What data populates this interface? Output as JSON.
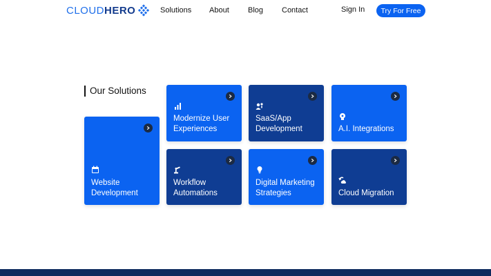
{
  "brand": {
    "part1": "CLOUD",
    "part2": "HERO"
  },
  "nav": {
    "items": [
      "Solutions",
      "About",
      "Blog",
      "Contact"
    ],
    "signin": "Sign In",
    "cta": "Try For Free"
  },
  "section": {
    "title": "Our Solutions"
  },
  "cards": [
    {
      "title": "Website Development",
      "icon": "calendar-icon"
    },
    {
      "title": "Modernize User Experiences",
      "icon": "bar-chart-icon"
    },
    {
      "title": "SaaS/App Development",
      "icon": "users-icon"
    },
    {
      "title": "A.I. Integrations",
      "icon": "lightbulb-head-icon"
    },
    {
      "title": "Workflow Automations",
      "icon": "robot-arm-icon"
    },
    {
      "title": "Digital Marketing Strategies",
      "icon": "lightbulb-icon"
    },
    {
      "title": "Cloud Migration",
      "icon": "cloud-sync-icon"
    }
  ],
  "colors": {
    "primary": "#0b63f1",
    "dark": "#0f3d93",
    "footer": "#0d2a5e"
  }
}
